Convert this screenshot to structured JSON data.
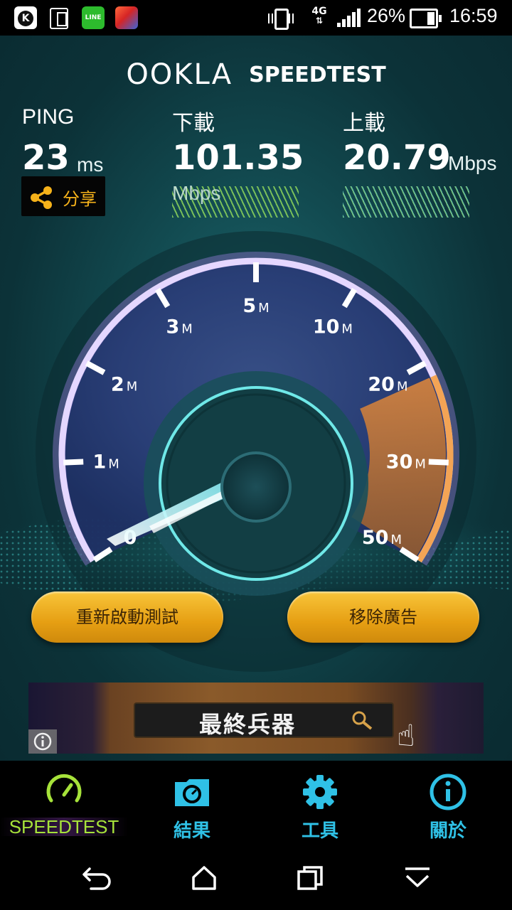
{
  "status_bar": {
    "line_label": "LINE",
    "network": "4G",
    "battery": "26%",
    "time": "16:59"
  },
  "brand": {
    "ookla": "OOKLA",
    "speedtest": "SPEEDTEST"
  },
  "results": {
    "ping": {
      "label": "PING",
      "value": "23",
      "unit": "ms"
    },
    "download": {
      "label": "下載",
      "value": "101.35",
      "unit": "Mbps"
    },
    "upload": {
      "label": "上載",
      "value": "20.79",
      "unit": "Mbps"
    }
  },
  "share": {
    "label": "分享"
  },
  "gauge": {
    "labels": [
      {
        "num": "0",
        "unit": ""
      },
      {
        "num": "1",
        "unit": "M"
      },
      {
        "num": "2",
        "unit": "M"
      },
      {
        "num": "3",
        "unit": "M"
      },
      {
        "num": "5",
        "unit": "M"
      },
      {
        "num": "10",
        "unit": "M"
      },
      {
        "num": "20",
        "unit": "M"
      },
      {
        "num": "30",
        "unit": "M"
      },
      {
        "num": "50",
        "unit": "M"
      }
    ]
  },
  "actions": {
    "restart": "重新啟動測試",
    "remove_ads": "移除廣告"
  },
  "ad": {
    "text": "最終兵器"
  },
  "tabs": [
    {
      "label": "SPEEDTEST",
      "icon": "speedometer-icon",
      "active": true
    },
    {
      "label": "結果",
      "icon": "results-folder-icon",
      "active": false
    },
    {
      "label": "工具",
      "icon": "gear-icon",
      "active": false
    },
    {
      "label": "關於",
      "icon": "info-icon",
      "active": false
    }
  ],
  "colors": {
    "accent_tab": "#2fc1e6",
    "active_tab": "#a6e23a",
    "share_text": "#f6b21a",
    "button": "#f0b22a"
  }
}
